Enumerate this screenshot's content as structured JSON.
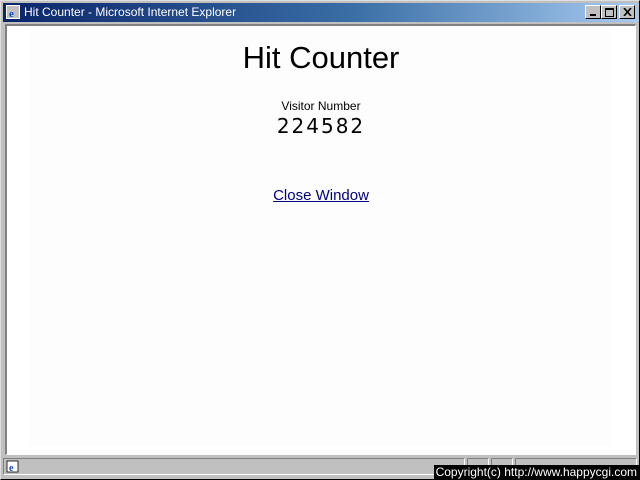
{
  "window": {
    "title": "Hit Counter - Microsoft Internet Explorer",
    "minimize_label": "_",
    "maximize_label": "□",
    "close_label": "✕"
  },
  "page": {
    "title": "Hit Counter",
    "visitor_label": "Visitor Number",
    "visitor_count": "224582",
    "close_link": "Close Window"
  },
  "statusbar": {
    "zone_text": ""
  },
  "overlay": {
    "copyright": "Copyright(c) http://www.happycgi.com"
  },
  "colors": {
    "titlebar_start": "#0a246a",
    "titlebar_end": "#a6caf0",
    "link": "#000080"
  },
  "icons": {
    "title_icon": "ie-icon",
    "status_icon": "ie-page-icon"
  }
}
